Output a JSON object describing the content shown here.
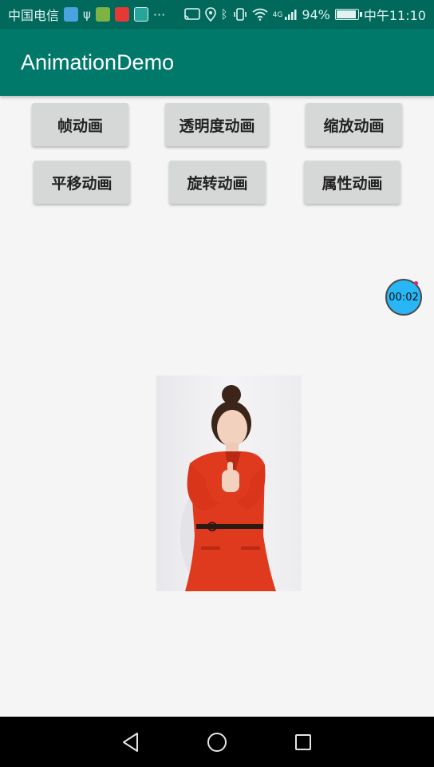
{
  "status_bar": {
    "carrier": "中国电信",
    "more": "···",
    "network": "4G",
    "battery": "94%",
    "battery_level": 0.94,
    "time": "中午11:10"
  },
  "app_bar": {
    "title": "AnimationDemo"
  },
  "buttons": {
    "frame": "帧动画",
    "alpha": "透明度动画",
    "scale": "缩放动画",
    "translate": "平移动画",
    "rotate": "旋转动画",
    "property": "属性动画"
  },
  "timer": {
    "text": "00:02"
  }
}
